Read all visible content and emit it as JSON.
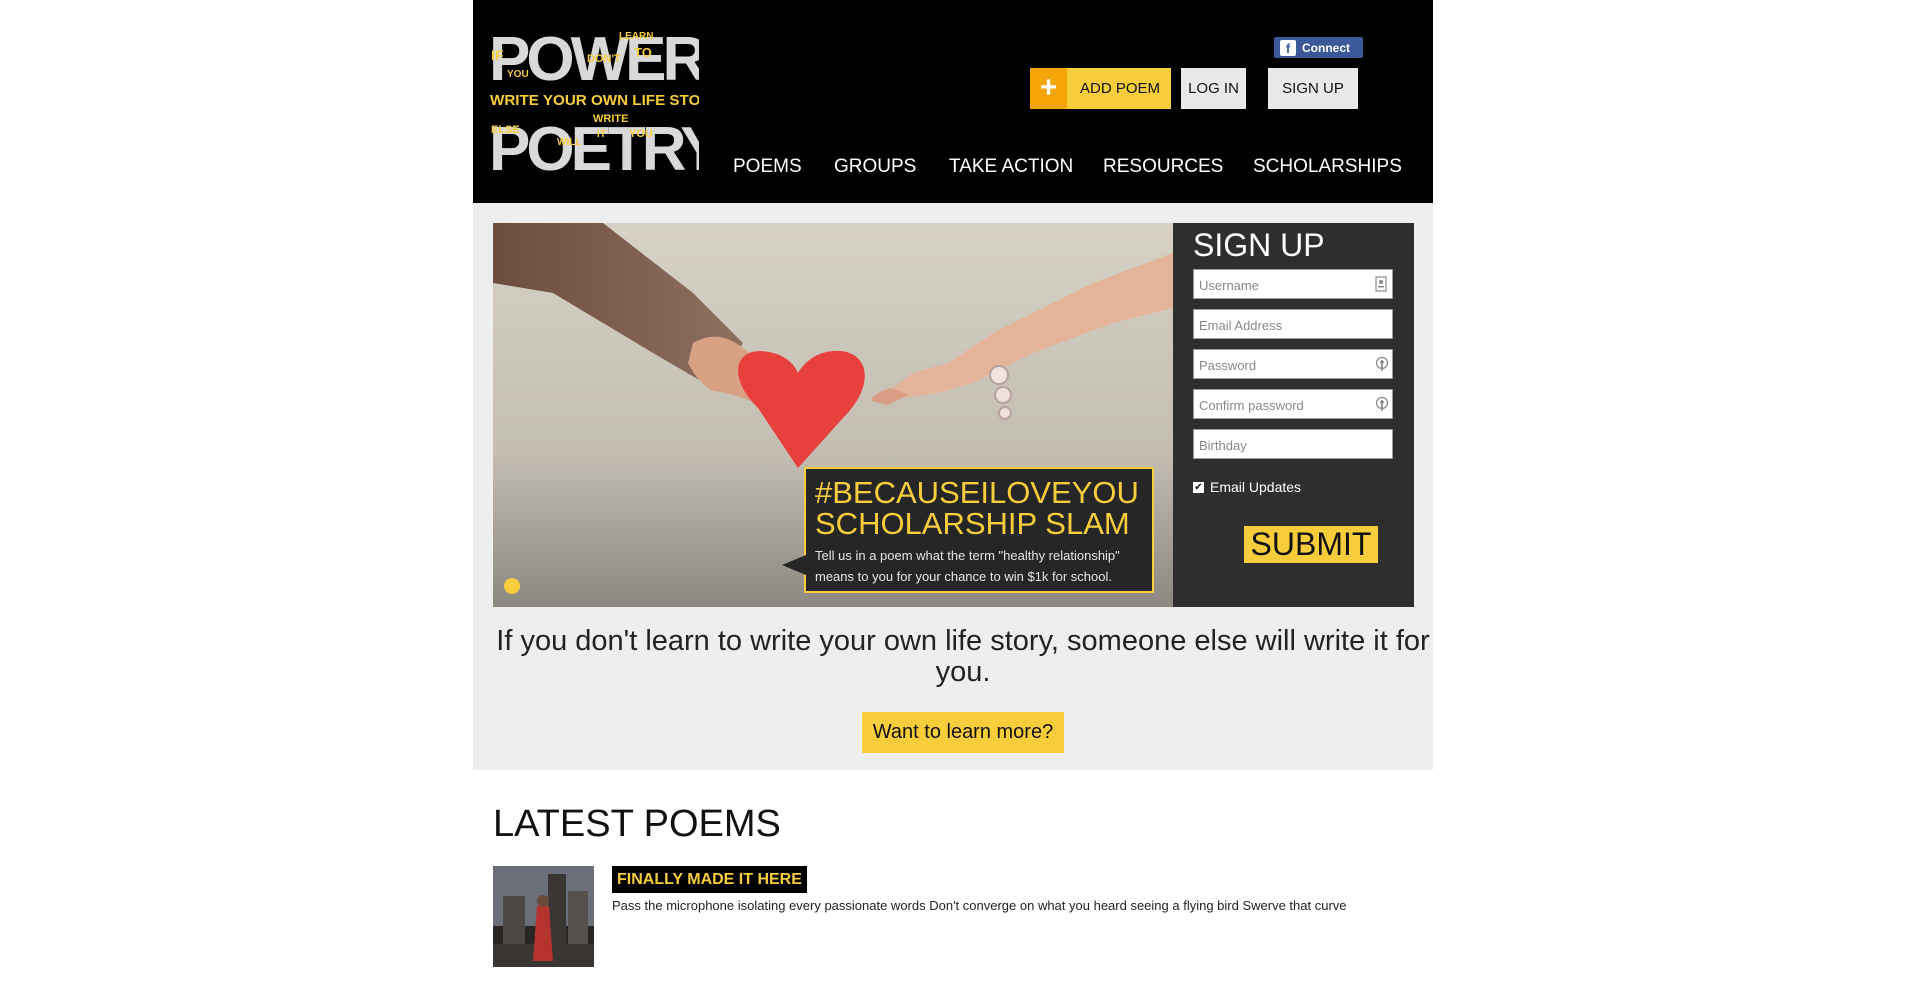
{
  "header": {
    "logo_alt": "Power Poetry - Write your own life story",
    "facebook_label": "Connect",
    "add_poem_label": "ADD POEM",
    "login_label": "LOG IN",
    "signup_label": "SIGN UP",
    "nav": [
      "POEMS",
      "GROUPS",
      "TAKE ACTION",
      "RESOURCES",
      "SCHOLARSHIPS"
    ]
  },
  "hero": {
    "title_line1": "#BECAUSEILOVEYOU",
    "title_line2": "SCHOLARSHIP SLAM",
    "desc_line1": "Tell us in a poem what the term \"healthy relationship\"",
    "desc_line2": "means to you for your chance to win $1k for school."
  },
  "signup_form": {
    "heading": "SIGN UP",
    "username_placeholder": "Username",
    "email_placeholder": "Email Address",
    "password_placeholder": "Password",
    "confirm_placeholder": "Confirm password",
    "birthday_placeholder": "Birthday",
    "email_updates_label": "Email Updates",
    "email_updates_checked": true,
    "submit_label": "SUBMIT"
  },
  "tagline": "If you don't learn to write your own life story, someone else will write it for you.",
  "learn_more_label": "Want to learn more?",
  "latest": {
    "heading": "LATEST POEMS",
    "poems": [
      {
        "title": "FINALLY MADE IT HERE",
        "excerpt": "Pass the microphone isolating every passionate words Don't converge on what you heard seeing a flying bird  Swerve that curve"
      }
    ]
  },
  "colors": {
    "accent_yellow": "#f8cd3c",
    "accent_orange": "#f3a50a",
    "header_black": "#000000",
    "band_grey": "#eeeeee",
    "facebook_blue": "#3b5998"
  }
}
